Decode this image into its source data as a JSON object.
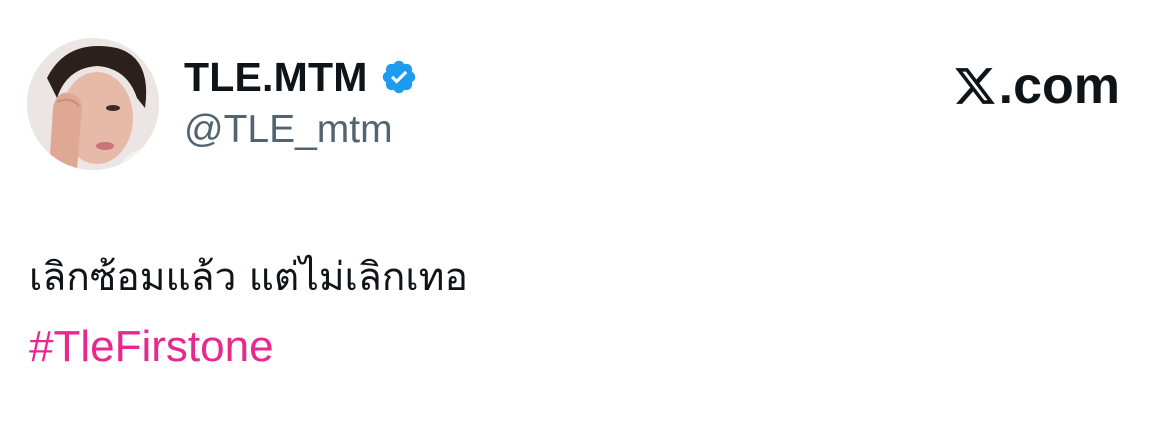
{
  "author": {
    "display_name": "TLE.MTM",
    "handle": "@TLE_mtm",
    "verified": true,
    "avatar": "profile-photo"
  },
  "brand": {
    "icon": "x-logo-icon",
    "label": ".com"
  },
  "tweet": {
    "text": "เลิกซ้อมแล้ว แต่ไม่เลิกเทอ",
    "hashtag": "#TleFirstone"
  },
  "colors": {
    "name": "#0f1419",
    "handle": "#536471",
    "verified_badge": "#1d9bf0",
    "hashtag": "#e8288c"
  }
}
